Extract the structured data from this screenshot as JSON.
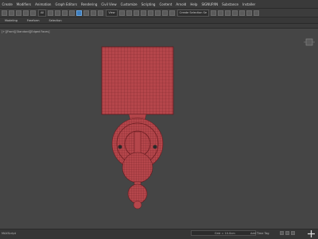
{
  "menubar": {
    "items": [
      "Create",
      "Modifiers",
      "Animation",
      "Graph Editors",
      "Rendering",
      "Civil View",
      "Customize",
      "Scripting",
      "Content",
      "Arnold",
      "Help",
      "SIGNUP/IN",
      "Substance",
      "Installer"
    ]
  },
  "toolbar": {
    "filter_label": "All",
    "view_label": "View",
    "selection_set_label": "Create Selection Se"
  },
  "ribbon": {
    "tabs": [
      "Modeling",
      "Freeform",
      "Selection"
    ]
  },
  "viewport": {
    "label": "[+][Front][Standard][Edged Faces]",
    "model_color": "#b5464b",
    "wire_color": "#6b1d22"
  },
  "statusbar": {
    "left_text": "MAXScript",
    "grid_text": "Grid = 10.0cm",
    "addtime_text": "Add Time Tag"
  }
}
